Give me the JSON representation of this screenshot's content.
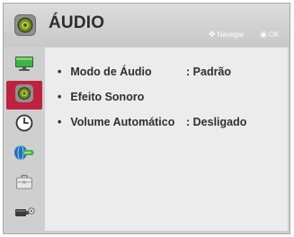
{
  "header": {
    "title": "ÁUDIO",
    "hints": {
      "navigate_label": "Navegar",
      "ok_label": "OK"
    },
    "icon": "speaker-icon"
  },
  "sidebar": {
    "items": [
      {
        "name": "picture",
        "icon": "monitor-icon",
        "active": false
      },
      {
        "name": "audio",
        "icon": "speaker-icon",
        "active": true
      },
      {
        "name": "time",
        "icon": "clock-icon",
        "active": false
      },
      {
        "name": "network",
        "icon": "network-icon",
        "active": false
      },
      {
        "name": "lock",
        "icon": "briefcase-icon",
        "active": false
      },
      {
        "name": "input",
        "icon": "device-icon",
        "active": false
      }
    ],
    "active_color": "#be2240"
  },
  "menu": {
    "items": [
      {
        "label": "Modo de Áudio",
        "separator": ":",
        "value": "Padrão"
      },
      {
        "label": "Efeito Sonoro",
        "separator": "",
        "value": ""
      },
      {
        "label": "Volume Automático",
        "separator": ":",
        "value": "Desligado"
      }
    ]
  }
}
